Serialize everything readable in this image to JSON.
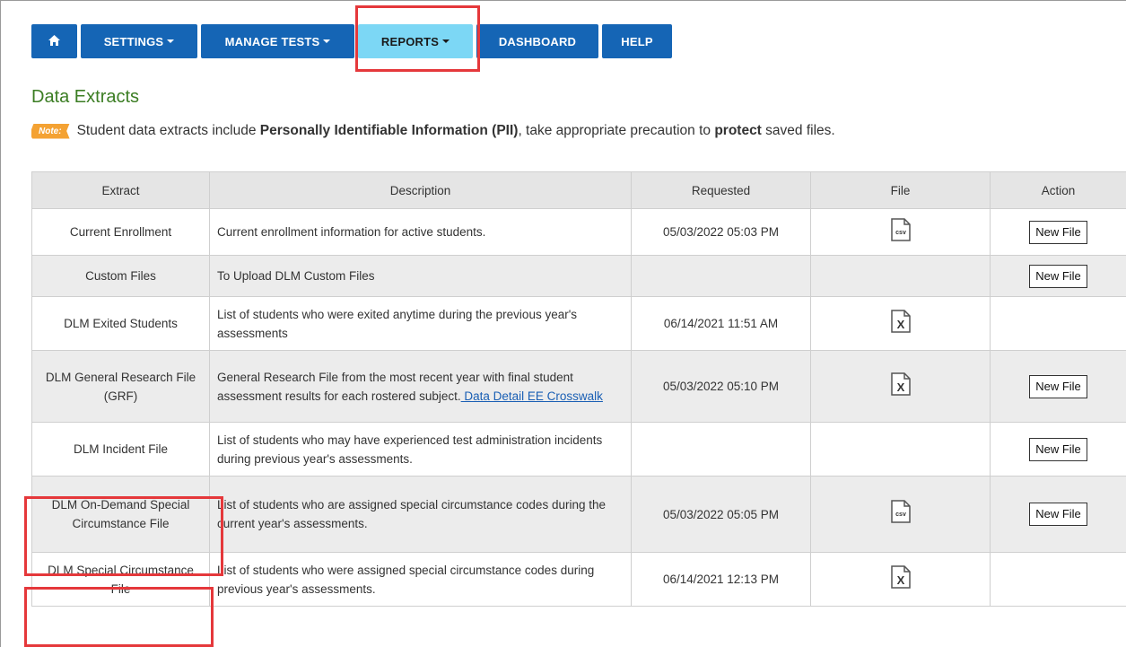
{
  "nav": {
    "home_icon": "home-icon",
    "settings": "SETTINGS",
    "manage_tests": "MANAGE TESTS",
    "reports": "REPORTS",
    "dashboard": "DASHBOARD",
    "help": "HELP",
    "active_color": "#7cd7f5",
    "button_color": "#1565b5"
  },
  "page": {
    "title": "Data Extracts",
    "note_label": "Note:",
    "note_text_1": "Student data extracts include ",
    "note_bold_1": "Personally Identifiable Information (PII)",
    "note_text_2": ", take appropriate precaution to ",
    "note_bold_2": "protect",
    "note_text_3": " saved files."
  },
  "table": {
    "headers": {
      "extract": "Extract",
      "description": "Description",
      "requested": "Requested",
      "file": "File",
      "action": "Action"
    },
    "new_file_label": "New File",
    "rows": [
      {
        "extract": "Current Enrollment",
        "description": "Current enrollment information for active students.",
        "requested": "05/03/2022 05:03 PM",
        "file": "csv-file-icon",
        "action": "New File"
      },
      {
        "extract": "Custom Files",
        "description": "To Upload DLM Custom Files",
        "requested": "",
        "file": "",
        "action": "New File"
      },
      {
        "extract": "DLM Exited Students",
        "description": "List of students who were exited anytime during the previous year's assessments",
        "requested": "06/14/2021 11:51 AM",
        "file": "excel-file-icon",
        "action": ""
      },
      {
        "extract": "DLM General Research File (GRF)",
        "description": "General Research File from the most recent year with final student assessment results for each rostered subject.",
        "description_link": " Data Detail EE Crosswalk",
        "requested": "05/03/2022 05:10 PM",
        "file": "excel-file-icon",
        "action": "New File"
      },
      {
        "extract": "DLM Incident File",
        "description": "List of students who may have experienced test administration incidents during previous year's assessments.",
        "requested": "",
        "file": "",
        "action": "New File"
      },
      {
        "extract": "DLM On-Demand Special Circumstance File",
        "description": "List of students who are assigned special circumstance codes during the current year's assessments.",
        "requested": "05/03/2022 05:05 PM",
        "file": "csv-file-icon",
        "action": "New File"
      },
      {
        "extract": "DLM Special Circumstance File",
        "description": "List of students who were assigned special circumstance codes during previous year's assessments.",
        "requested": "06/14/2021 12:13 PM",
        "file": "excel-file-icon",
        "action": ""
      }
    ]
  },
  "highlight_color": "#e5383b"
}
